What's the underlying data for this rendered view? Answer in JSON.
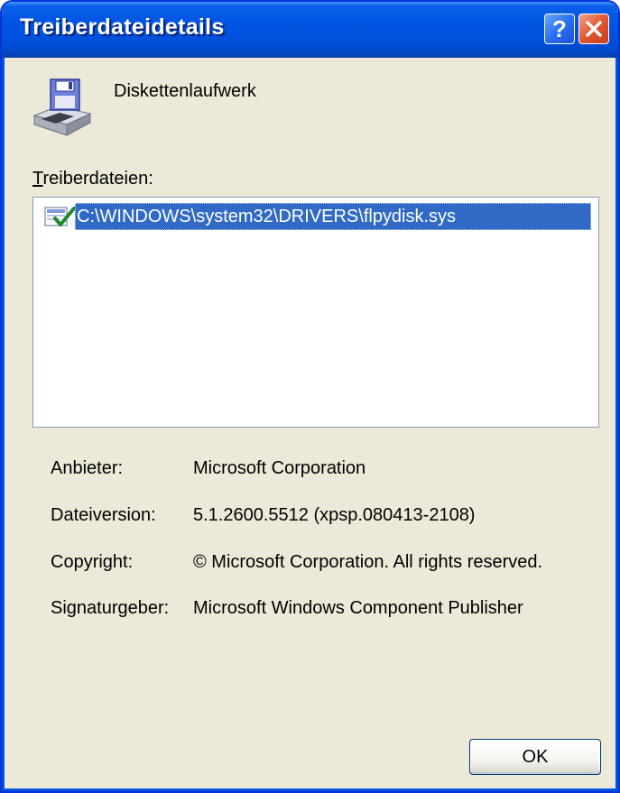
{
  "window": {
    "title": "Treiberdateidetails",
    "help_glyph": "?",
    "colors": {
      "titlebar": "#0054e3",
      "dialog_bg": "#ece9d8",
      "selection": "#316ac5",
      "list_border": "#7f9db9"
    }
  },
  "device": {
    "icon": "floppy-drive-icon",
    "name": "Diskettenlaufwerk"
  },
  "files": {
    "label_mnemonic": "T",
    "label_rest": "reiberdateien:",
    "items": [
      {
        "icon": "signed-file-icon",
        "path": "C:\\WINDOWS\\system32\\DRIVERS\\flpydisk.sys",
        "selected": true
      }
    ]
  },
  "details": {
    "provider_label": "Anbieter:",
    "provider_value": "Microsoft Corporation",
    "version_label": "Dateiversion:",
    "version_value": "5.1.2600.5512 (xpsp.080413-2108)",
    "copyright_label": "Copyright:",
    "copyright_value": "© Microsoft Corporation. All rights reserved.",
    "signer_label": "Signaturgeber:",
    "signer_value": "Microsoft Windows Component Publisher"
  },
  "buttons": {
    "ok_label": "OK"
  }
}
